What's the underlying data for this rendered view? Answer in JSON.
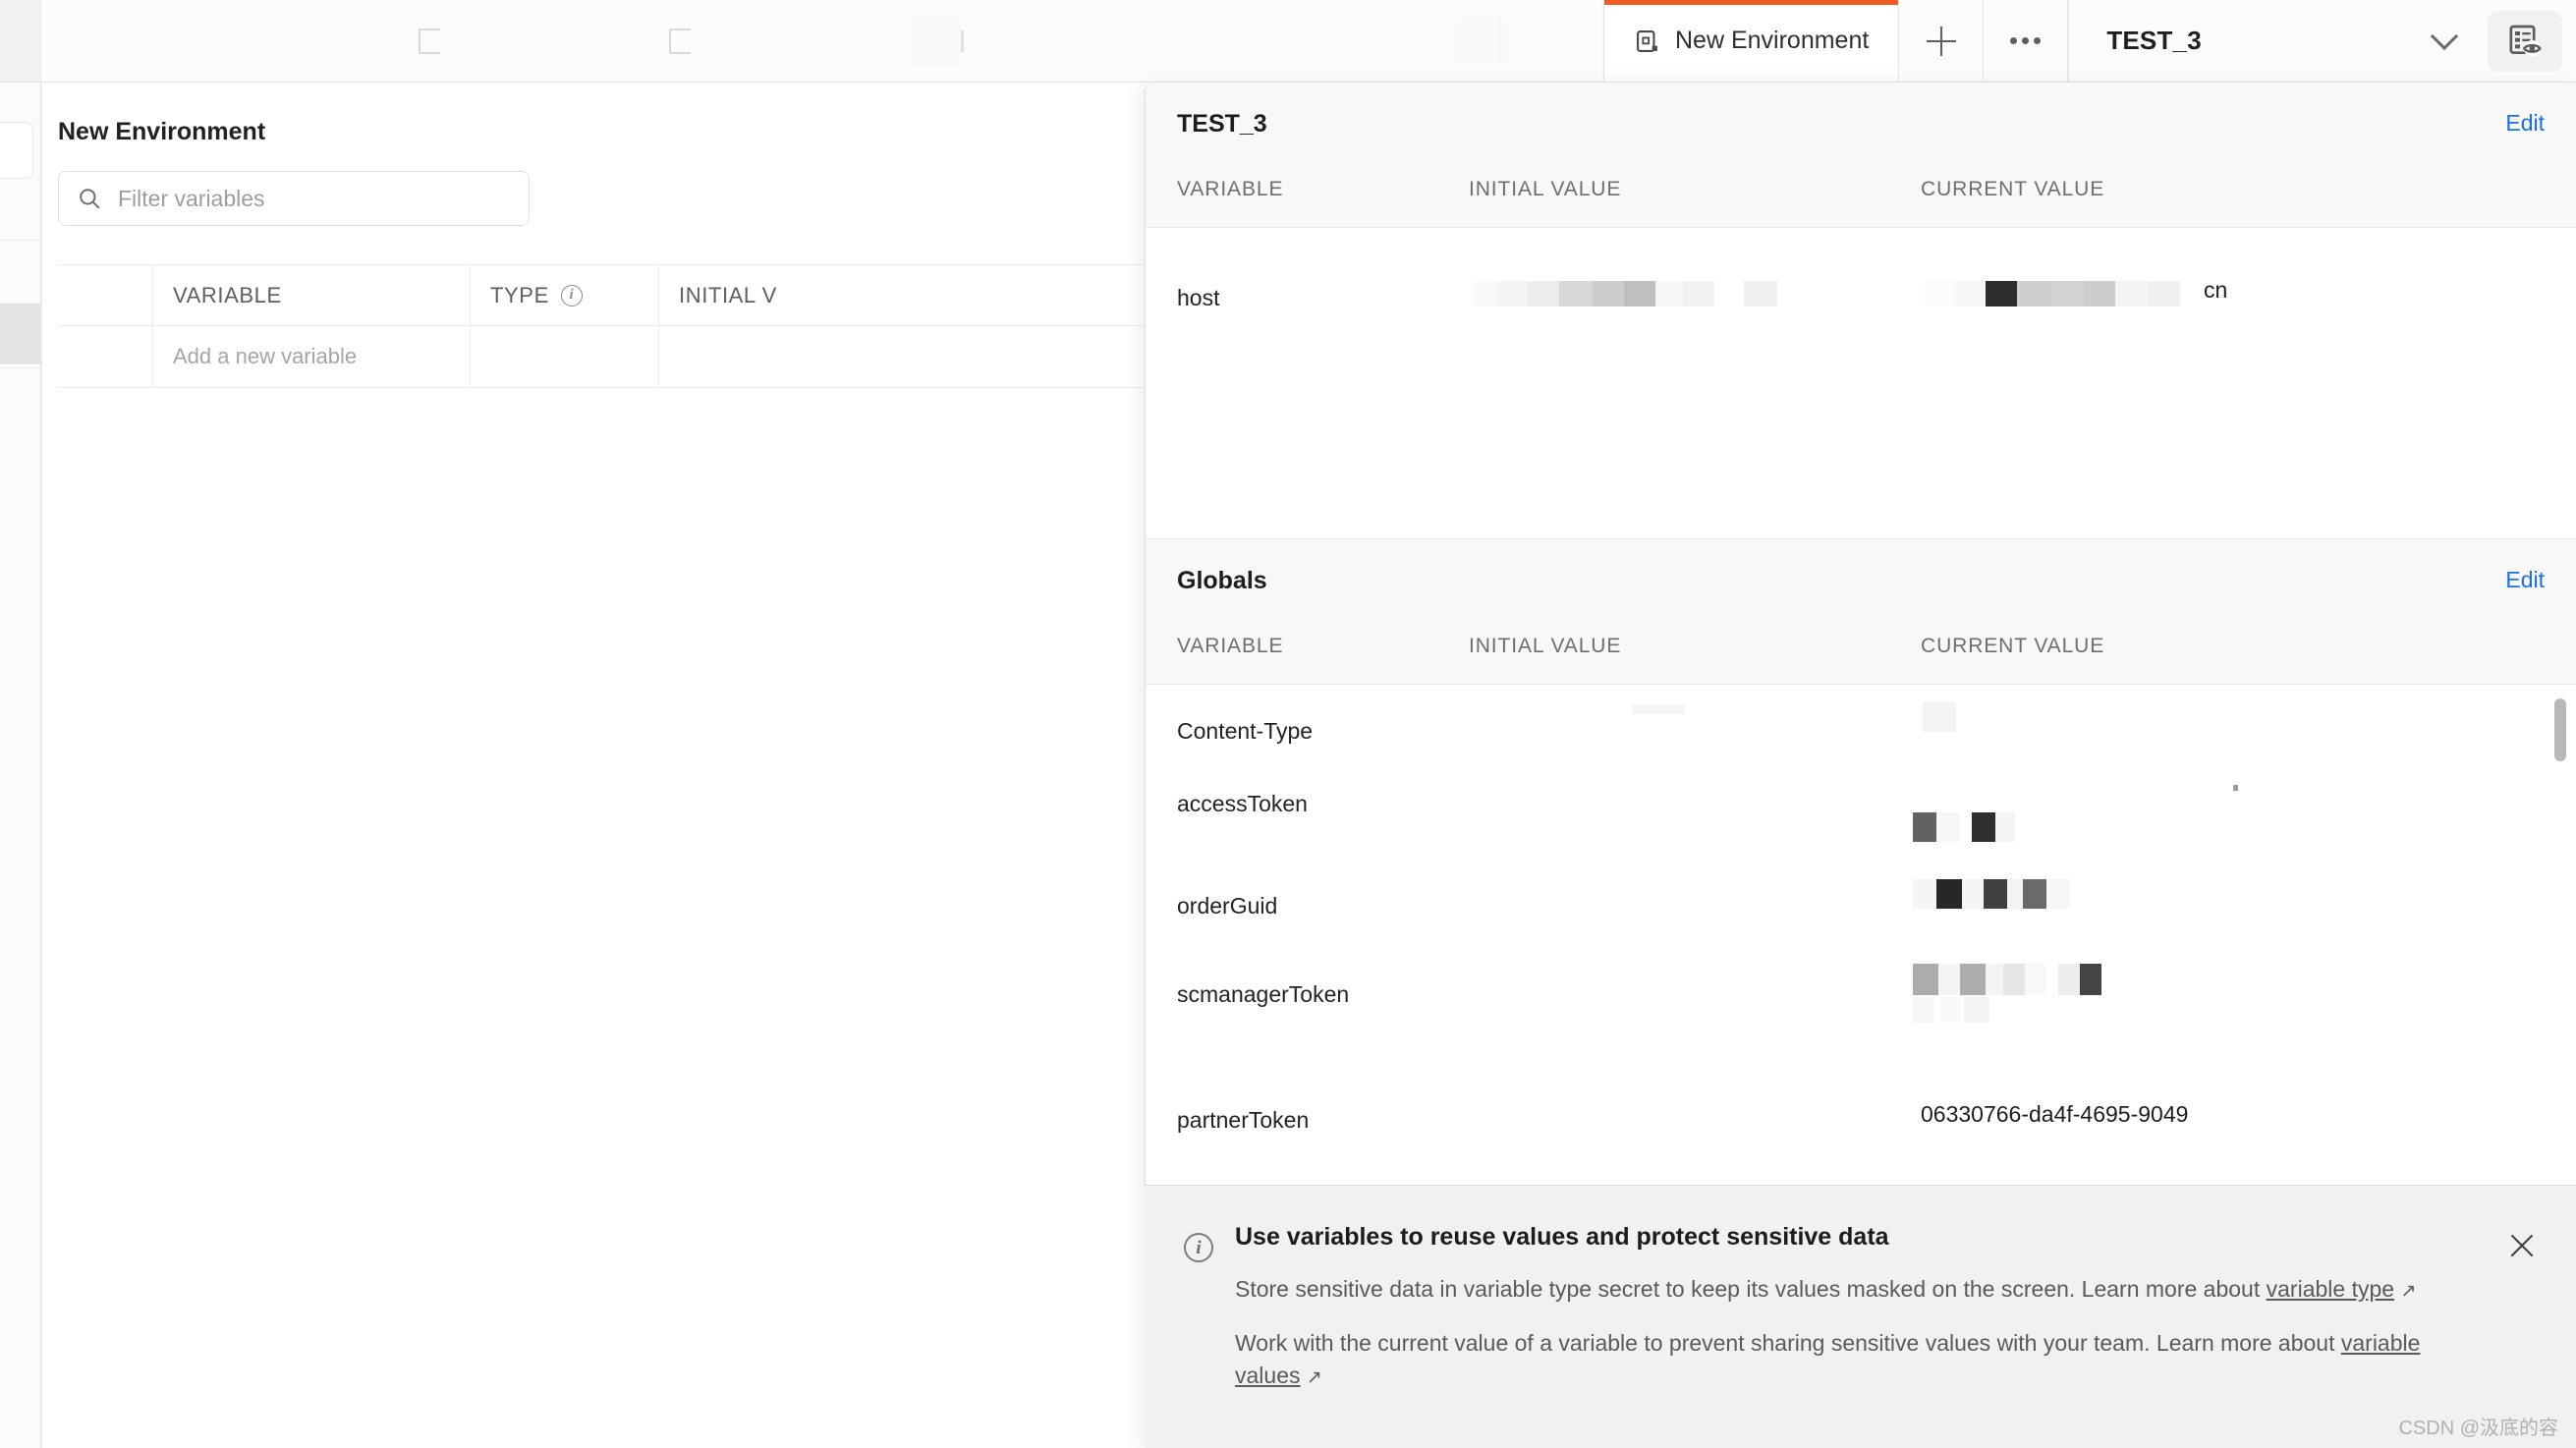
{
  "theme": {
    "accent": "#ef5b25",
    "link": "#1a6ff0",
    "panel_bg": "#ffffff",
    "header_bg": "#f8f8f8",
    "banner_bg": "#f1f1f1"
  },
  "topbar": {
    "env_tab": {
      "label": "New Environment",
      "icon": "environment-icon"
    },
    "new_tab_label": "+",
    "more_label": "•••",
    "env_selector": {
      "value": "TEST_3",
      "caret": "chevron-down-icon"
    },
    "quick_look_icon": "environment-quick-look-icon"
  },
  "left": {
    "title": "New Environment",
    "filter": {
      "placeholder": "Filter variables",
      "value": "",
      "icon": "search-icon"
    },
    "table": {
      "columns": [
        "",
        "VARIABLE",
        "TYPE",
        "INITIAL V"
      ],
      "type_info_icon": "info-icon",
      "new_row_placeholder": "Add a new variable"
    }
  },
  "overlay": {
    "sections": [
      {
        "title": "TEST_3",
        "edit_label": "Edit",
        "columns": [
          "VARIABLE",
          "INITIAL VALUE",
          "CURRENT VALUE"
        ],
        "rows": [
          {
            "name": "host",
            "initial_value": "",
            "current_value": "",
            "current_suffix": "cn",
            "redacted": true
          }
        ]
      },
      {
        "title": "Globals",
        "edit_label": "Edit",
        "columns": [
          "VARIABLE",
          "INITIAL VALUE",
          "CURRENT VALUE"
        ],
        "rows": [
          {
            "name": "Content-Type",
            "initial_value": "",
            "current_value": "",
            "redacted": true
          },
          {
            "name": "accessToken",
            "initial_value": "",
            "current_value": "",
            "redacted": true
          },
          {
            "name": "orderGuid",
            "initial_value": "",
            "current_value": "",
            "redacted": true
          },
          {
            "name": "scmanagerToken",
            "initial_value": "",
            "current_value": "",
            "redacted": true
          },
          {
            "name": "partnerToken",
            "initial_value": "",
            "current_value": "06330766-da4f-4695-9049",
            "redacted": false
          }
        ]
      }
    ]
  },
  "banner": {
    "icon": "info-icon",
    "title": "Use variables to reuse values and protect sensitive data",
    "line1_prefix": "Store sensitive data in variable type secret to keep its values masked on the screen. Learn more about ",
    "line1_link": "variable type",
    "line2_prefix": "Work with the current value of a variable to prevent sharing sensitive values with your team. Learn more about ",
    "line2_link": "variable values",
    "external_arrow": "↗",
    "close_icon": "close-icon"
  },
  "watermark": "CSDN @汲底的容"
}
